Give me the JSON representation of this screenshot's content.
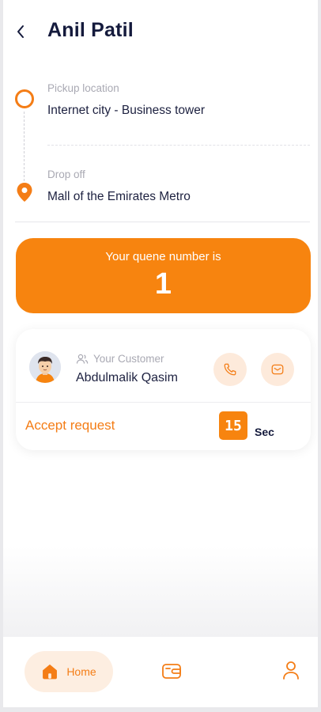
{
  "header": {
    "title": "Anil Patil"
  },
  "route": {
    "pickup_label": "Pickup location",
    "pickup_value": "Internet city - Business tower",
    "dropoff_label": "Drop off",
    "dropoff_value": "Mall of the Emirates Metro"
  },
  "queue": {
    "label": "Your quene number is",
    "number": "1"
  },
  "customer": {
    "label": "Your Customer",
    "name": "Abdulmalik Qasim",
    "accept_label": "Accept request",
    "timer_value": "15",
    "timer_unit": "Sec"
  },
  "nav": {
    "home_label": "Home"
  },
  "colors": {
    "accent": "#f7840f",
    "text_dark": "#141a3c",
    "muted": "#a9a9b3"
  },
  "icons": {
    "back": "chevron-left-icon",
    "pickup": "pickup-pin-icon",
    "dropoff": "location-pin-icon",
    "customer": "user-group-icon",
    "call": "phone-icon",
    "message": "message-icon",
    "home": "home-icon",
    "wallet": "wallet-icon",
    "profile": "profile-icon"
  }
}
